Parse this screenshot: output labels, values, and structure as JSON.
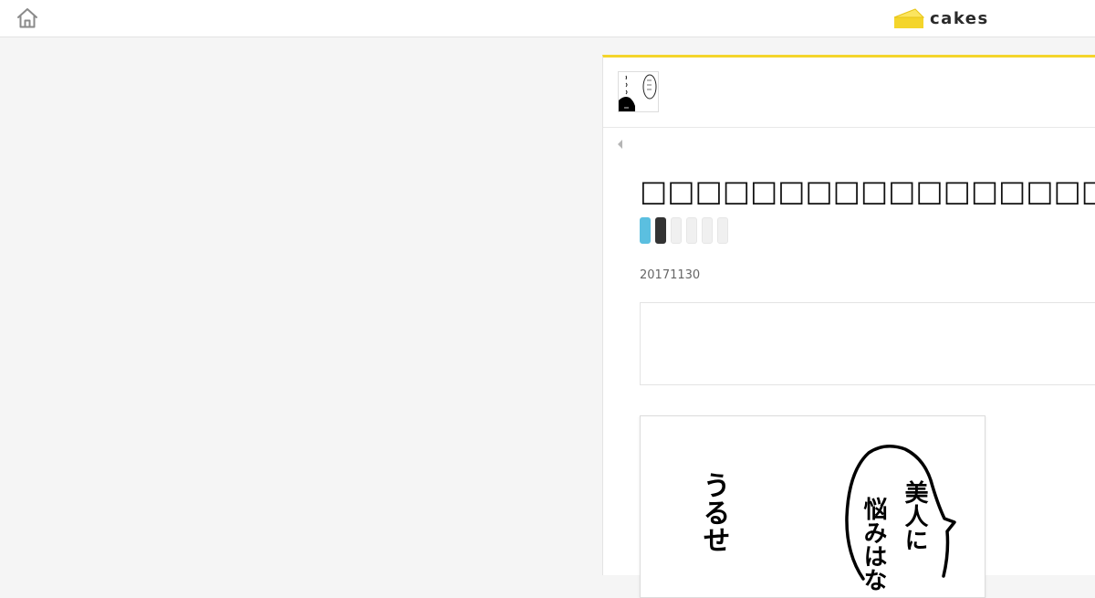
{
  "header": {
    "home_icon": "home-icon",
    "logo_text": "cakes",
    "logo_icon": "cheese-wedge-icon",
    "accent_color": "#f4d52b"
  },
  "article": {
    "back_icon": "triangle-left-icon",
    "title": "□□□□□□□□□□□□□□□□□□□□□□□□□□□□□□",
    "date": "20171130",
    "tag_colors": [
      "#5bbfe0",
      "#333333",
      "#f0f0f0",
      "#f0f0f0",
      "#f0f0f0",
      "#f0f0f0"
    ],
    "comic_text": {
      "left_column": "うるせ",
      "bubble_col1": "美人に",
      "bubble_col2": "悩みはな"
    }
  }
}
